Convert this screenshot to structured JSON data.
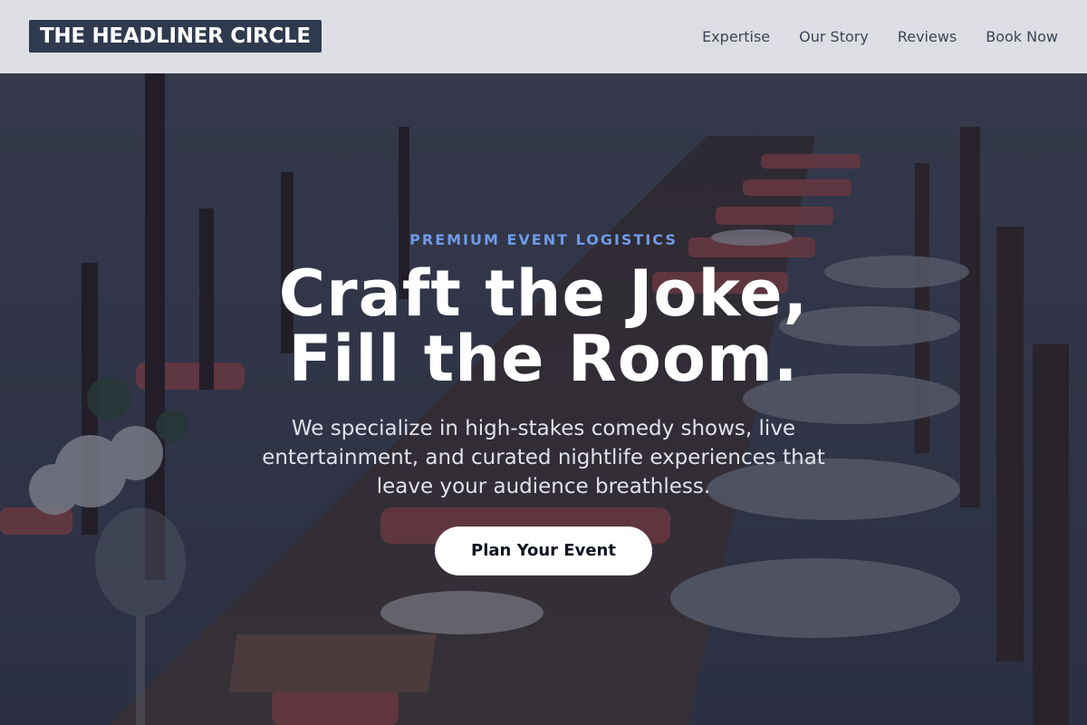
{
  "header": {
    "logo_text": "THE HEADLINER CIRCLE",
    "nav": [
      {
        "label": "Expertise"
      },
      {
        "label": "Our Story"
      },
      {
        "label": "Reviews"
      },
      {
        "label": "Book Now"
      }
    ]
  },
  "hero": {
    "eyebrow": "PREMIUM EVENT LOGISTICS",
    "headline_line1": "Craft the Joke,",
    "headline_line2": "Fill the Room.",
    "subtext": "We specialize in high-stakes comedy shows, live entertainment, and curated nightlife experiences that leave your audience breathless.",
    "cta_label": "Plan Your Event"
  },
  "colors": {
    "logo_bg": "#2f3a4e",
    "accent": "#6e9be8",
    "overlay": "#181c2d",
    "header_bg": "#e8e9ed"
  }
}
